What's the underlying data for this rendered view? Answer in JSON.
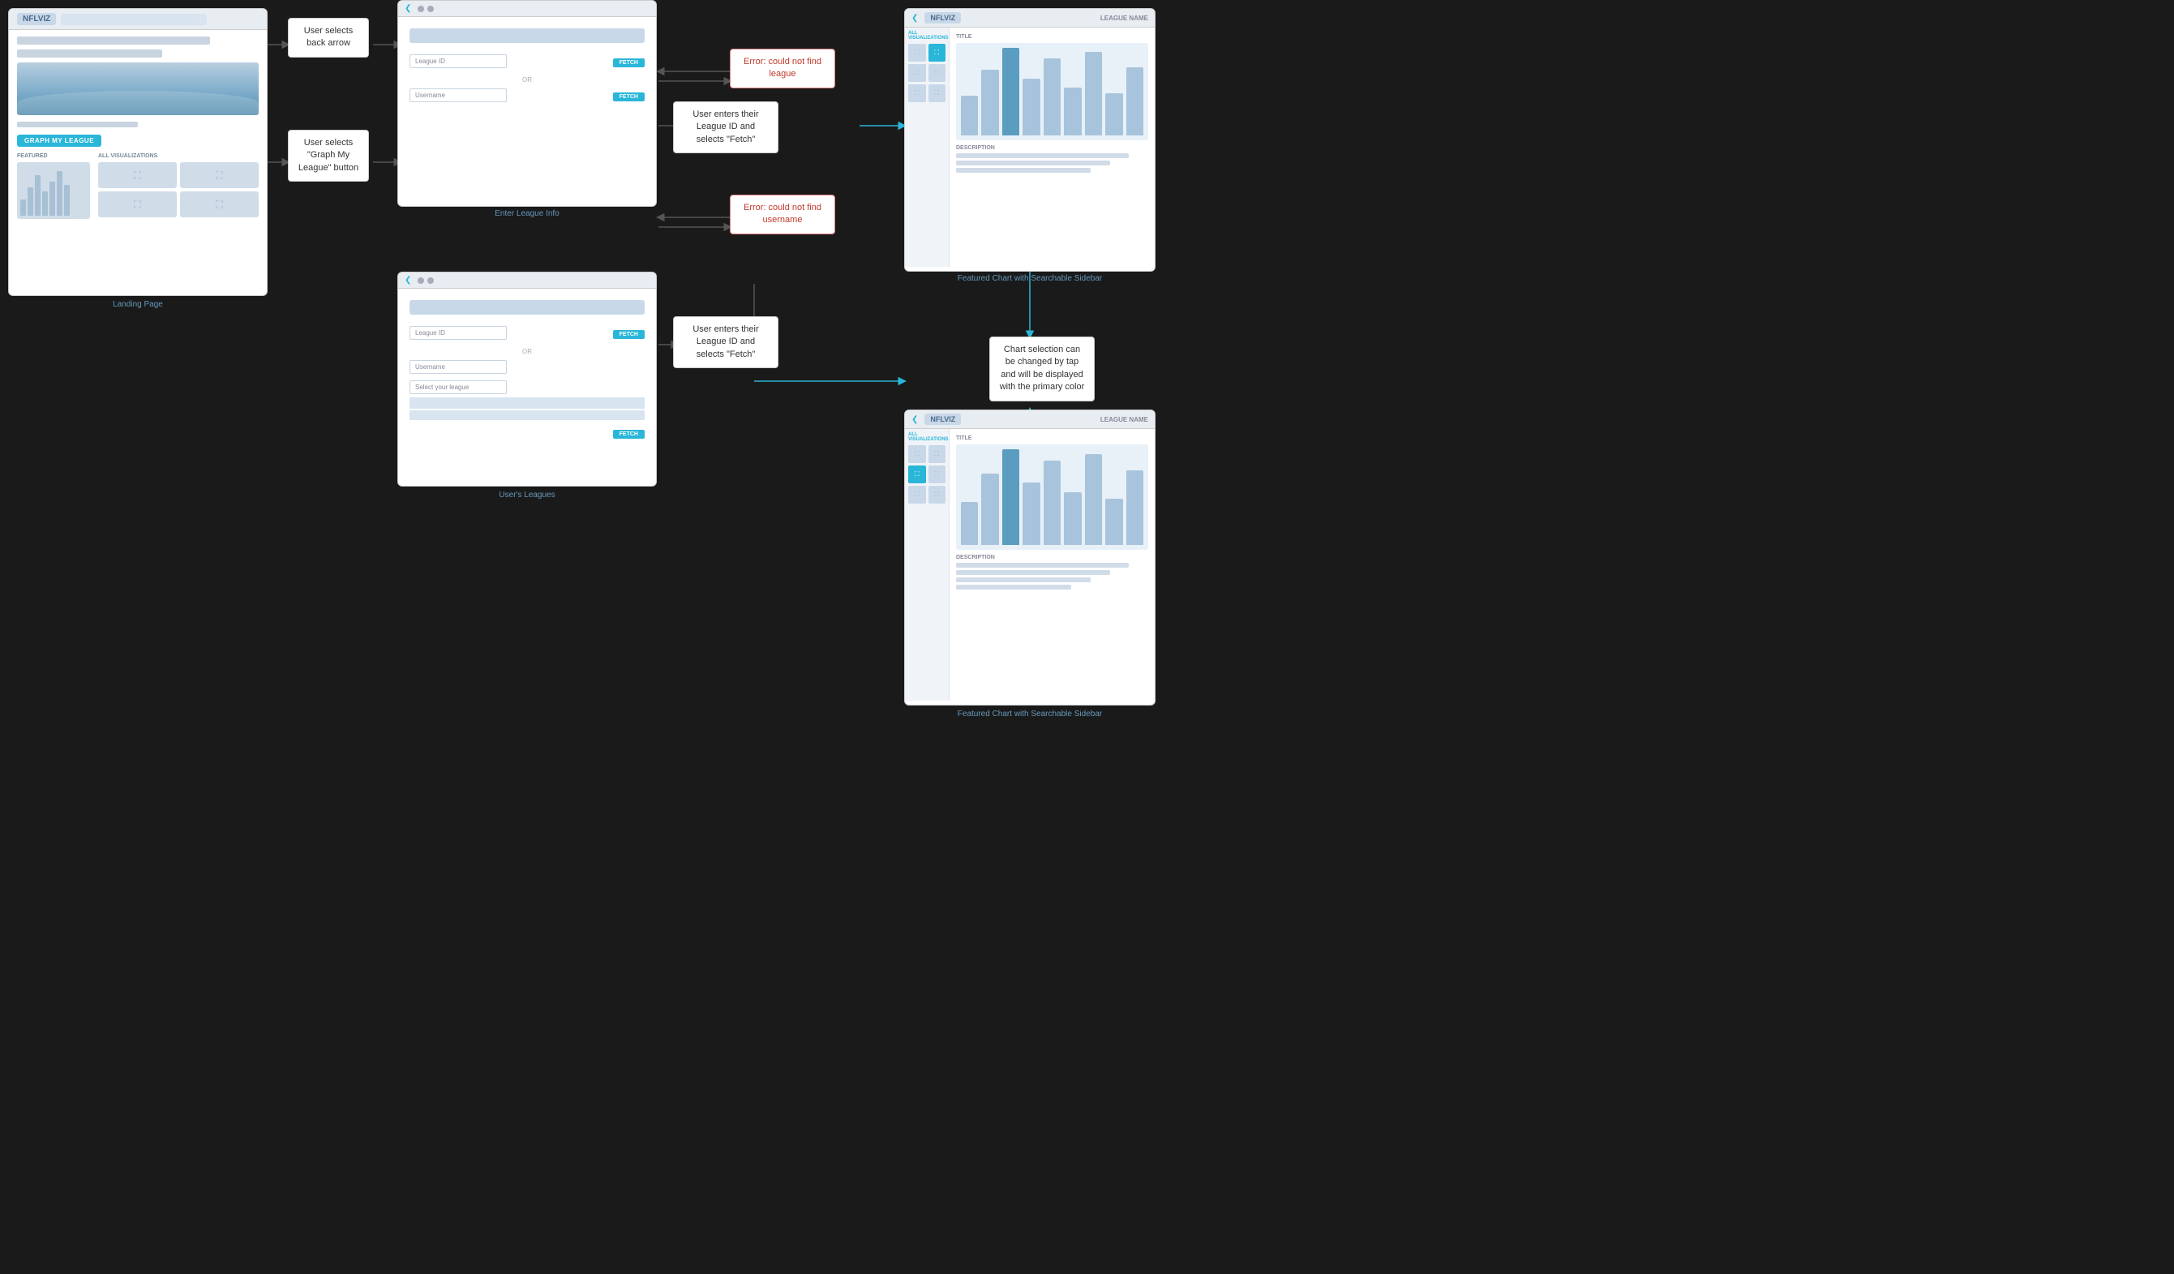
{
  "app": {
    "name": "NFLVIZ",
    "background": "#1a1a1a"
  },
  "screens": {
    "landing": {
      "label": "Landing Page",
      "logo": "NFLVIZ",
      "graph_button": "GRAPH MY LEAGUE",
      "featured_label": "FEATURED",
      "all_viz_label": "ALL VISUALIZATIONS",
      "bars": [
        30,
        50,
        70,
        45,
        60,
        80,
        55
      ]
    },
    "enter_league_top": {
      "caption": "Enter League Info",
      "league_id_label": "League ID",
      "or_text": "OR",
      "username_label": "Username",
      "fetch_label": "FETCH"
    },
    "enter_league_bottom": {
      "caption": "User's Leagues",
      "league_id_label": "League ID",
      "or_text": "OR",
      "username_label": "Username",
      "select_label": "Select your league",
      "fetch_label": "FETCH"
    },
    "chart_top": {
      "caption": "Featured Chart with Searchable Sidebar",
      "logo": "NFLVIZ",
      "league_name": "LEAGUE NAME",
      "all_viz": "ALL VISUALIZATIONS",
      "title_label": "TITLE",
      "description_label": "DESCRIPTION",
      "bars": [
        40,
        70,
        100,
        60,
        85,
        50,
        90,
        45,
        75
      ]
    },
    "chart_bottom": {
      "caption": "Featured Chart with Searchable Sidebar",
      "logo": "NFLVIZ",
      "league_name": "LEAGUE NAME",
      "all_viz": "ALL VISUALIZATIONS",
      "title_label": "TITLE",
      "description_label": "DESCRIPTION",
      "bars": [
        40,
        70,
        100,
        60,
        85,
        50,
        90,
        45,
        75
      ]
    }
  },
  "annotations": {
    "back_arrow": "User selects back arrow",
    "graph_my_league": "User selects \"Graph My League\" button",
    "error_league": "Error: could not find league",
    "fetch_league_id": "User enters their League ID and selects \"Fetch\"",
    "error_username": "Error: could not find username",
    "fetch_league_id2": "User enters their League ID and selects \"Fetch\"",
    "chart_selection": "Chart selection can be changed by tap and will be displayed with the primary color"
  },
  "labels": {
    "landing": "Landing Page",
    "enter_league": "Enter League Info",
    "users_leagues": "User's Leagues",
    "chart_top": "Featured Chart with Searchable Sidebar",
    "chart_bottom": "Featured Chart with Searchable Sidebar"
  }
}
